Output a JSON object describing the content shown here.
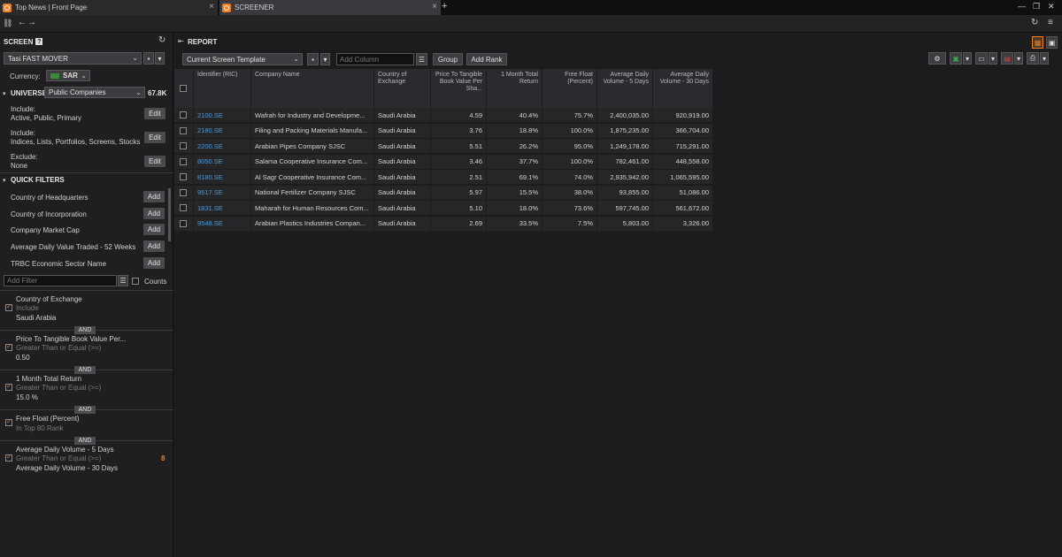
{
  "tabs": [
    {
      "label": "Top News | Front Page"
    },
    {
      "label": "SCREENER"
    }
  ],
  "screen": {
    "title": "SCREEN",
    "help": "?",
    "selected_screen": "Tasi FAST MOVER",
    "currency_label": "Currency:",
    "currency": "SAR",
    "universe_label": "UNIVERSE",
    "universe_value": "Public Companies",
    "universe_count": "67.8K",
    "rules": [
      {
        "title": "Include:",
        "value": "Active, Public, Primary",
        "button": "Edit"
      },
      {
        "title": "Include:",
        "value": "Indices, Lists, Portfolios, Screens, Stocks",
        "button": "Edit"
      },
      {
        "title": "Exclude:",
        "value": "None",
        "button": "Edit"
      }
    ],
    "quick_filters_label": "QUICK FILTERS",
    "quick_filters": [
      {
        "label": "Country of Headquarters",
        "button": "Add"
      },
      {
        "label": "Country of Incorporation",
        "button": "Add"
      },
      {
        "label": "Company Market Cap",
        "button": "Add"
      },
      {
        "label": "Average Daily Value Traded - 52 Weeks",
        "button": "Add"
      },
      {
        "label": "TRBC Economic Sector Name",
        "button": "Add"
      }
    ],
    "add_filter_placeholder": "Add Filter",
    "counts_label": "Counts",
    "and_label": "AND",
    "criteria": [
      {
        "name": "Country of Exchange",
        "op": "Include",
        "value": "Saudi Arabia"
      },
      {
        "name": "Price To Tangible Book Value Per...",
        "op": "Greater Than or Equal (>=)",
        "value": "0.50"
      },
      {
        "name": "1 Month Total Return",
        "op": "Greater Than or Equal (>=)",
        "value": "15.0 %"
      },
      {
        "name": "Free Float (Percent)",
        "op": "In Top 80 Rank",
        "value": ""
      },
      {
        "name": "Average Daily Volume - 5 Days",
        "op": "Greater Than or Equal (>=)",
        "value": "Average Daily Volume - 30 Days",
        "count": "8"
      }
    ]
  },
  "report": {
    "title": "REPORT",
    "template": "Current Screen Template",
    "add_column_placeholder": "Add Column",
    "group_button": "Group",
    "add_rank_button": "Add Rank",
    "columns": [
      "Identifier (RIC)",
      "Company Name",
      "Country of Exchange",
      "Price To Tangible Book Value Per Sha...",
      "1 Month Total Return",
      "Free Float (Percent)",
      "Average Daily Volume - 5 Days",
      "Average Daily Volume - 30 Days"
    ],
    "rows": [
      [
        "2100.SE",
        "Wafrah for Industry and Developme...",
        "Saudi Arabia",
        "4.59",
        "40.4%",
        "75.7%",
        "2,400,035.00",
        "920,919.00"
      ],
      [
        "2180.SE",
        "Filing and Packing Materials Manufa...",
        "Saudi Arabia",
        "3.76",
        "18.8%",
        "100.0%",
        "1,875,235.00",
        "366,704.00"
      ],
      [
        "2200.SE",
        "Arabian Pipes Company SJSC",
        "Saudi Arabia",
        "5.51",
        "26.2%",
        "95.0%",
        "1,249,178.00",
        "715,291.00"
      ],
      [
        "8050.SE",
        "Salama Cooperative Insurance Com...",
        "Saudi Arabia",
        "3.46",
        "37.7%",
        "100.0%",
        "782,461.00",
        "448,558.00"
      ],
      [
        "8180.SE",
        "Al Sagr Cooperative Insurance Com...",
        "Saudi Arabia",
        "2.51",
        "69.1%",
        "74.0%",
        "2,935,942.00",
        "1,065,595.00"
      ],
      [
        "9517.SE",
        "National Fertilizer Company SJSC",
        "Saudi Arabia",
        "5.97",
        "15.5%",
        "38.0%",
        "93,855.00",
        "51,086.00"
      ],
      [
        "1831.SE",
        "Maharah for Human Resources Com...",
        "Saudi Arabia",
        "5.10",
        "18.0%",
        "73.6%",
        "597,745.00",
        "561,672.00"
      ],
      [
        "9548.SE",
        "Arabian Plastics Industries Compan...",
        "Saudi Arabia",
        "2.69",
        "33.5%",
        "7.5%",
        "5,803.00",
        "3,326.00"
      ]
    ]
  },
  "colors": {
    "accent": "#f07d1f",
    "link": "#4f9ad8",
    "bg": "#1c1c1f"
  }
}
